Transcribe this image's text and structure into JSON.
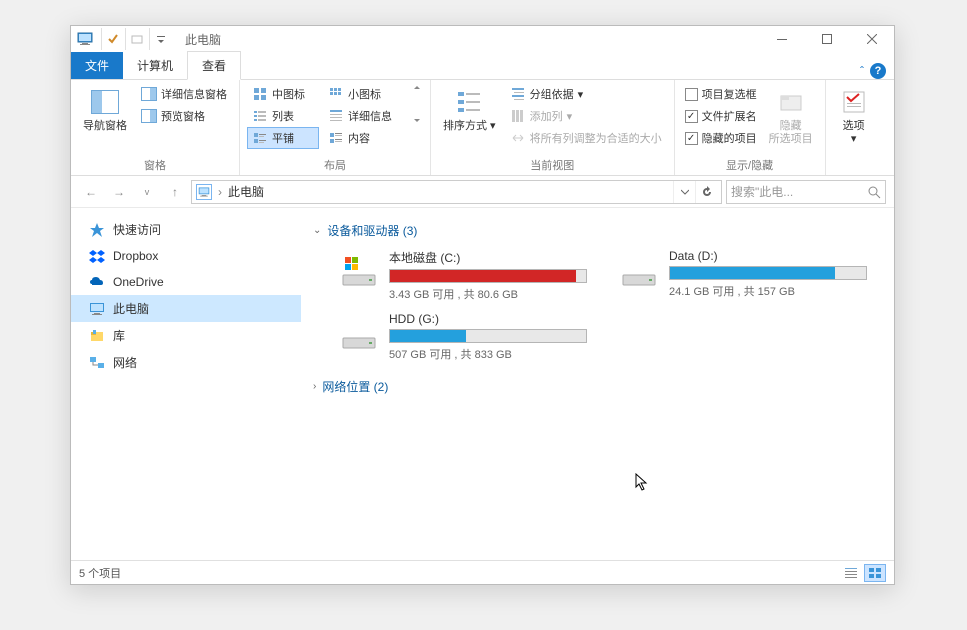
{
  "title": "此电脑",
  "tabs": {
    "file": "文件",
    "computer": "计算机",
    "view": "查看"
  },
  "ribbon": {
    "panes": {
      "label": "窗格",
      "nav_pane": "导航窗格",
      "details_pane": "详细信息窗格",
      "preview_pane": "预览窗格"
    },
    "layout": {
      "label": "布局",
      "medium_icons": "中图标",
      "small_icons": "小图标",
      "list": "列表",
      "details": "详细信息",
      "tiles": "平铺",
      "content": "内容"
    },
    "current_view": {
      "label": "当前视图",
      "sort_by": "排序方式",
      "group_by": "分组依据",
      "add_columns": "添加列",
      "size_all": "将所有列调整为合适的大小"
    },
    "show_hide": {
      "label": "显示/隐藏",
      "item_checkboxes": "项目复选框",
      "file_ext": "文件扩展名",
      "hidden_items": "隐藏的项目",
      "hide_selected": "隐藏",
      "hide_selected_sub": "所选项目"
    },
    "options": {
      "label": "选项"
    }
  },
  "address": {
    "location": "此电脑"
  },
  "search": {
    "placeholder": "搜索\"此电..."
  },
  "sidebar": {
    "items": [
      {
        "label": "快速访问",
        "icon": "quick-access"
      },
      {
        "label": "Dropbox",
        "icon": "dropbox"
      },
      {
        "label": "OneDrive",
        "icon": "onedrive"
      },
      {
        "label": "此电脑",
        "icon": "pc",
        "selected": true
      },
      {
        "label": "库",
        "icon": "libraries"
      },
      {
        "label": "网络",
        "icon": "network"
      }
    ]
  },
  "groups": {
    "devices": {
      "label": "设备和驱动器 (3)",
      "expanded": true
    },
    "network": {
      "label": "网络位置 (2)",
      "expanded": false
    }
  },
  "drives": [
    {
      "name": "本地磁盘 (C:)",
      "info": "3.43 GB 可用 , 共 80.6 GB",
      "fill_pct": 95,
      "color": "#d22626",
      "system": true
    },
    {
      "name": "Data (D:)",
      "info": "24.1 GB 可用 , 共 157 GB",
      "fill_pct": 84,
      "color": "#24a0dd",
      "system": false
    },
    {
      "name": "HDD (G:)",
      "info": "507 GB 可用 , 共 833 GB",
      "fill_pct": 39,
      "color": "#24a0dd",
      "system": false
    }
  ],
  "status": {
    "text": "5 个项目"
  }
}
